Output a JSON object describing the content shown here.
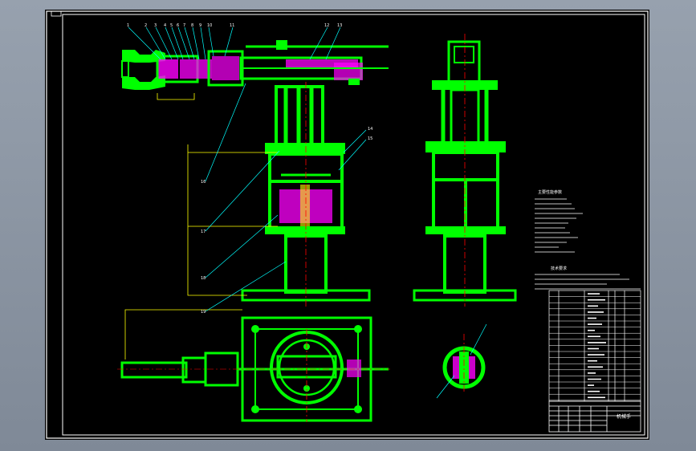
{
  "drawing": {
    "background": "#000000",
    "colors": {
      "part": "#00ff00",
      "frame": "#ffffff",
      "leader": "#00ffff",
      "hatch": "#ff00ff",
      "center": "#ff0000",
      "dim": "#ffff00"
    },
    "part_labels": [
      "1",
      "2",
      "3",
      "4",
      "5",
      "6",
      "7",
      "8",
      "9",
      "10",
      "11",
      "12",
      "13",
      "14",
      "15",
      "16",
      "17",
      "18",
      "19"
    ],
    "notes_title": "技术要求",
    "spec_title": "主要性能参数",
    "title_block_name": "机械手"
  }
}
